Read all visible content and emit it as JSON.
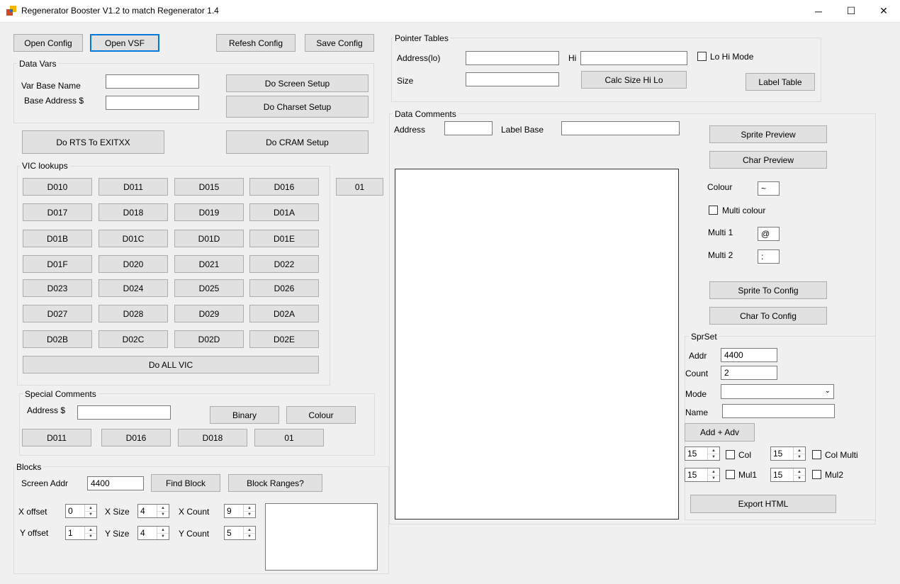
{
  "window": {
    "title": "Regenerator Booster V1.2 to match Regenerator 1.4",
    "min": "─",
    "max": "☐",
    "close": "✕"
  },
  "toolbar": {
    "open_config": "Open Config",
    "open_vsf": "Open VSF",
    "refresh_config": "Refesh Config",
    "save_config": "Save Config"
  },
  "data_vars": {
    "title": "Data Vars",
    "var_base_name": "Var Base Name",
    "base_address": "Base Address $",
    "var_base_value": "",
    "base_address_value": "",
    "do_screen_setup": "Do Screen Setup",
    "do_charset_setup": "Do Charset Setup"
  },
  "actions": {
    "do_rts": "Do RTS To EXITXX",
    "do_cram": "Do CRAM Setup"
  },
  "vic": {
    "title": "VIC lookups",
    "rows": [
      [
        "D010",
        "D011",
        "D015",
        "D016"
      ],
      [
        "D017",
        "D018",
        "D019",
        "D01A"
      ],
      [
        "D01B",
        "D01C",
        "D01D",
        "D01E"
      ],
      [
        "D01F",
        "D020",
        "D021",
        "D022"
      ],
      [
        "D023",
        "D024",
        "D025",
        "D026"
      ],
      [
        "D027",
        "D028",
        "D029",
        "D02A"
      ],
      [
        "D02B",
        "D02C",
        "D02D",
        "D02E"
      ]
    ],
    "do_all": "Do ALL VIC",
    "extra": "01"
  },
  "special": {
    "title": "Special Comments",
    "address": "Address $",
    "address_value": "",
    "binary": "Binary",
    "colour": "Colour",
    "b1": "D011",
    "b2": "D016",
    "b3": "D018",
    "b4": "01"
  },
  "blocks": {
    "title": "Blocks",
    "screen_addr": "Screen Addr",
    "screen_addr_value": "4400",
    "find_block": "Find Block",
    "block_ranges": "Block Ranges?",
    "x_offset": "X offset",
    "x_offset_value": "0",
    "x_size": "X Size",
    "x_size_value": "4",
    "x_count": "X Count",
    "x_count_value": "9",
    "y_offset": "Y offset",
    "y_offset_value": "1",
    "y_size": "Y Size",
    "y_size_value": "4",
    "y_count": "Y Count",
    "y_count_value": "5"
  },
  "pointer": {
    "title": "Pointer Tables",
    "address_lo": "Address(lo)",
    "hi": "Hi",
    "size": "Size",
    "lo_hi_mode": "Lo Hi Mode",
    "calc": "Calc Size Hi Lo",
    "label_table": "Label Table"
  },
  "data_comments": {
    "title": "Data Comments",
    "address": "Address",
    "label_base": "Label Base"
  },
  "preview": {
    "sprite_preview": "Sprite Preview",
    "char_preview": "Char Preview",
    "colour": "Colour",
    "colour_value": "~",
    "multi_colour": "Multi colour",
    "multi1": "Multi 1",
    "multi1_value": "@",
    "multi2": "Multi 2",
    "multi2_value": ":",
    "sprite_to_config": "Sprite To Config",
    "char_to_config": "Char To Config"
  },
  "sprset": {
    "title": "SprSet",
    "addr": "Addr",
    "addr_value": "4400",
    "count": "Count",
    "count_value": "2",
    "mode": "Mode",
    "mode_value": "",
    "name": "Name",
    "name_value": "",
    "add_adv": "Add + Adv",
    "col_value": "15",
    "col": "Col",
    "col_multi_value": "15",
    "col_multi": "Col Multi",
    "mul1_value": "15",
    "mul1": "Mul1",
    "mul2_value": "15",
    "mul2": "Mul2",
    "export_html": "Export HTML"
  }
}
